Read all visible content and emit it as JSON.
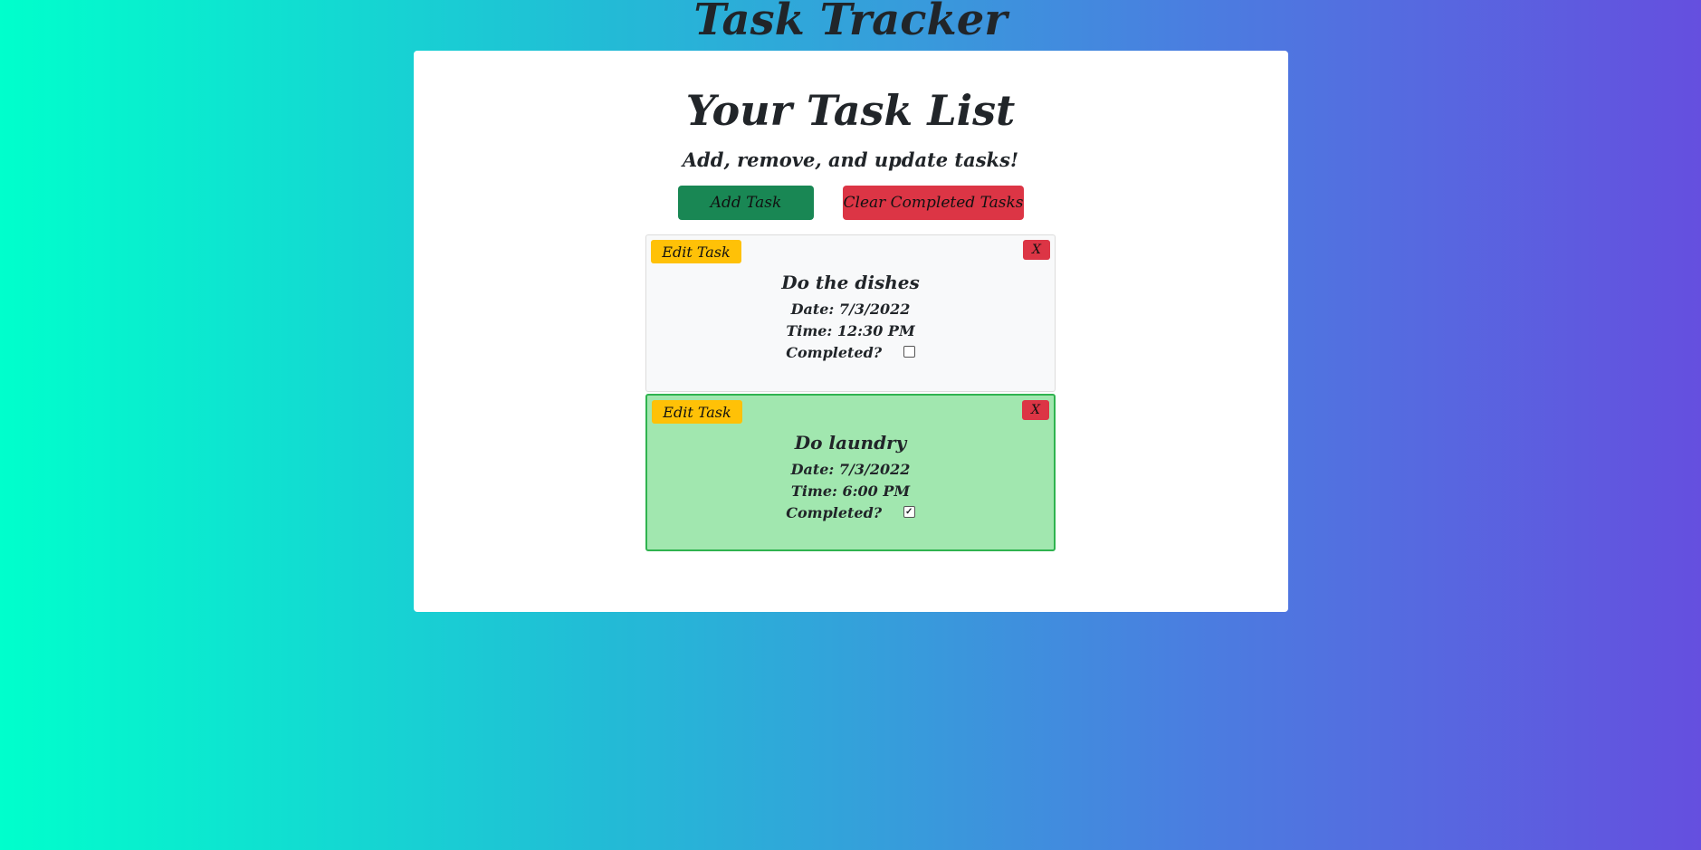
{
  "app": {
    "title": "Task Tracker"
  },
  "main": {
    "title": "Your Task List",
    "subtitle": "Add, remove, and update tasks!",
    "add_button": "Add Task",
    "clear_button": "Clear Completed Tasks"
  },
  "tasks": [
    {
      "edit_label": "Edit Task",
      "delete_label": "X",
      "name": "Do the dishes",
      "date": "Date: 7/3/2022",
      "time": "Time: 12:30 PM",
      "completed_label": "Completed?",
      "completed": false
    },
    {
      "edit_label": "Edit Task",
      "delete_label": "X",
      "name": "Do laundry",
      "date": "Date: 7/3/2022",
      "time": "Time: 6:00 PM",
      "completed_label": "Completed?",
      "completed": true
    }
  ],
  "colors": {
    "add": "#198754",
    "clear": "#dc3545",
    "edit": "#ffc107",
    "completed_bg": "#a1e7af"
  }
}
